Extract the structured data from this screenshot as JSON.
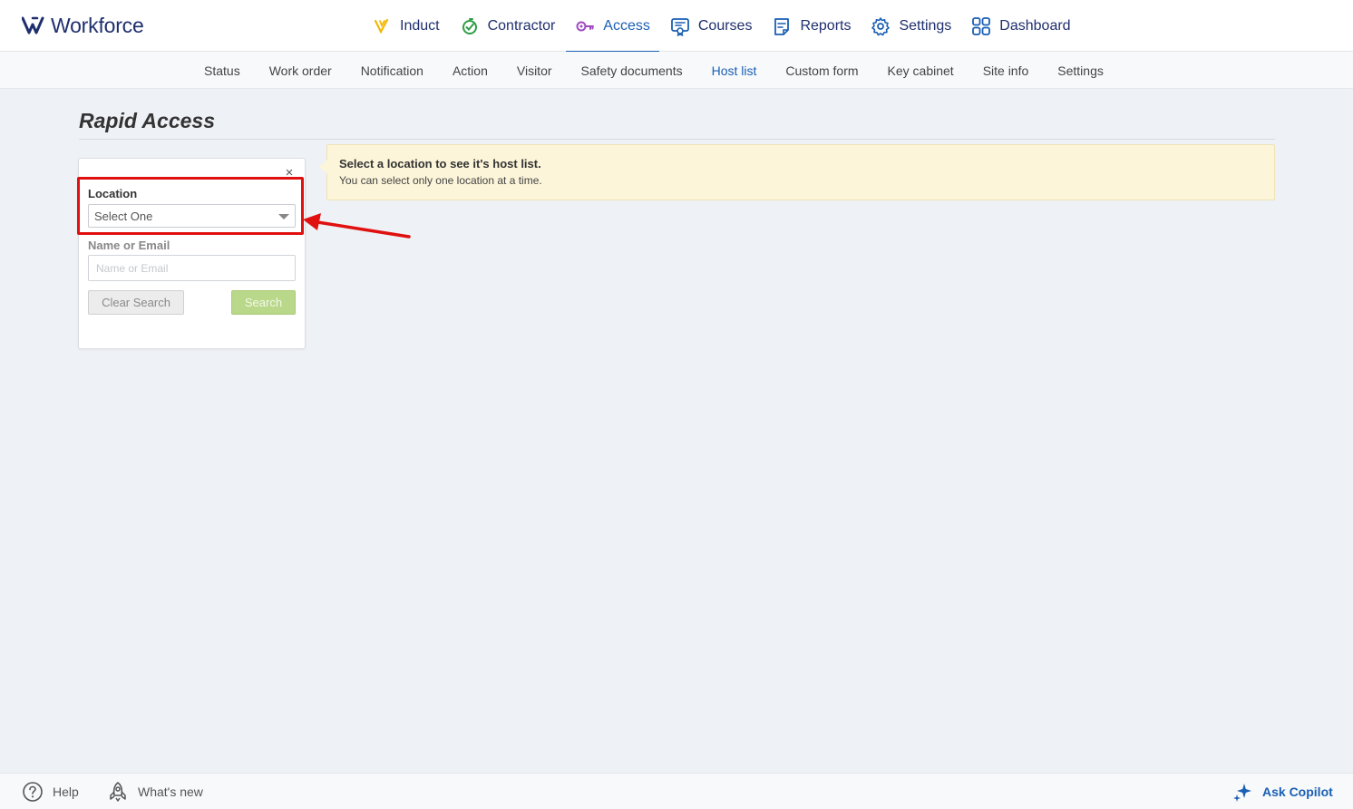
{
  "app": {
    "name": "Workforce",
    "brand_color": "#1f2f6e",
    "accent_color": "#1a5fb4"
  },
  "main_nav": [
    {
      "label": "Induct",
      "icon": "induct-icon",
      "active": false
    },
    {
      "label": "Contractor",
      "icon": "contractor-icon",
      "active": false
    },
    {
      "label": "Access",
      "icon": "access-key-icon",
      "active": true
    },
    {
      "label": "Courses",
      "icon": "courses-icon",
      "active": false
    },
    {
      "label": "Reports",
      "icon": "reports-icon",
      "active": false
    },
    {
      "label": "Settings",
      "icon": "gear-icon",
      "active": false
    },
    {
      "label": "Dashboard",
      "icon": "dashboard-grid-icon",
      "active": false
    }
  ],
  "sub_nav": [
    {
      "label": "Status",
      "active": false
    },
    {
      "label": "Work order",
      "active": false
    },
    {
      "label": "Notification",
      "active": false
    },
    {
      "label": "Action",
      "active": false
    },
    {
      "label": "Visitor",
      "active": false
    },
    {
      "label": "Safety documents",
      "active": false
    },
    {
      "label": "Host list",
      "active": true
    },
    {
      "label": "Custom form",
      "active": false
    },
    {
      "label": "Key cabinet",
      "active": false
    },
    {
      "label": "Site info",
      "active": false
    },
    {
      "label": "Settings",
      "active": false
    }
  ],
  "page": {
    "title": "Rapid Access"
  },
  "search_panel": {
    "close_symbol": "×",
    "location_label": "Location",
    "location_value": "Select One",
    "name_label": "Name or Email",
    "name_placeholder": "Name or Email",
    "clear_button": "Clear Search",
    "search_button": "Search"
  },
  "info_message": {
    "title": "Select a location to see it's host list.",
    "subtitle": "You can select only one location at a time."
  },
  "footer": {
    "help": "Help",
    "whats_new": "What's new",
    "ask_copilot": "Ask Copilot"
  }
}
